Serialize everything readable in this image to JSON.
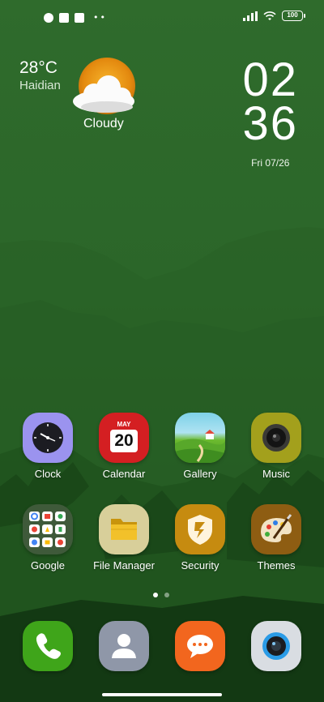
{
  "status_bar": {
    "battery": "100"
  },
  "weather": {
    "temperature": "28°C",
    "city": "Haidian",
    "condition": "Cloudy"
  },
  "clock": {
    "hours": "02",
    "minutes": "36",
    "date": "Fri 07/26"
  },
  "apps_row1": [
    {
      "label": "Clock"
    },
    {
      "label": "Calendar",
      "month": "MAY",
      "day": "20"
    },
    {
      "label": "Gallery"
    },
    {
      "label": "Music"
    }
  ],
  "apps_row2": [
    {
      "label": "Google"
    },
    {
      "label": "File Manager"
    },
    {
      "label": "Security"
    },
    {
      "label": "Themes"
    }
  ],
  "dock": [
    {
      "icon": "phone-icon"
    },
    {
      "icon": "contacts-icon"
    },
    {
      "icon": "messages-icon"
    },
    {
      "icon": "camera-icon"
    }
  ],
  "pager": {
    "pages": 2,
    "current": 1
  }
}
